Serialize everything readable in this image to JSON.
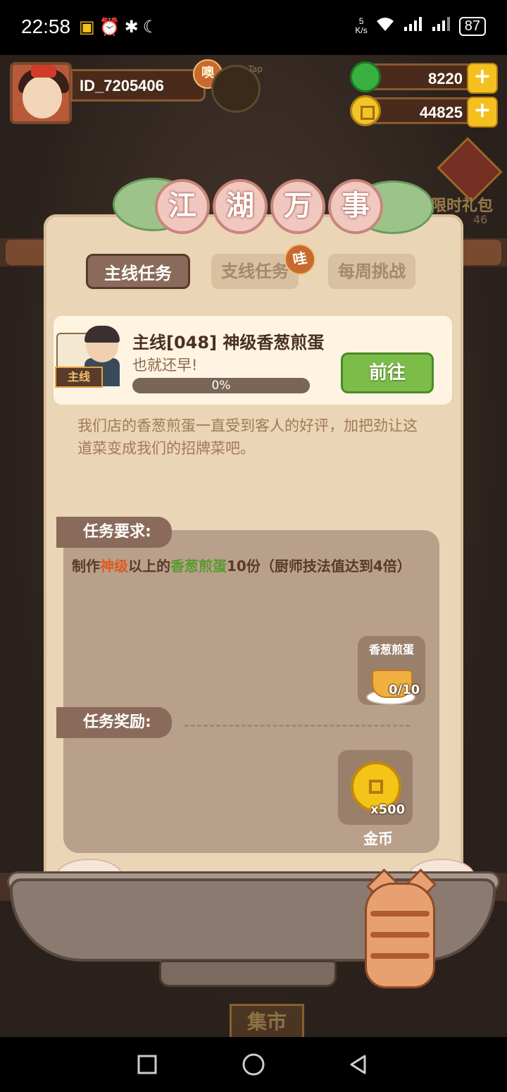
{
  "status_bar": {
    "time": "22:58",
    "net_speed": "5\nK/s",
    "battery": "87"
  },
  "hud": {
    "player_id": "ID_7205406",
    "id_badge": "噢",
    "tap_label": "Tap",
    "jade": "8220",
    "coins": "44825"
  },
  "side_event": {
    "label": "限时礼包",
    "timer": "46"
  },
  "panel": {
    "title_chars": [
      "江",
      "湖",
      "万",
      "事"
    ],
    "tabs": [
      {
        "label": "主线任务",
        "active": true
      },
      {
        "label": "支线任务",
        "active": false
      },
      {
        "label": "每周挑战",
        "active": false
      }
    ],
    "tab_badge": "哇"
  },
  "task": {
    "tag": "主线",
    "title": "主线[048] 神级香葱煎蛋",
    "subtitle": "也就还早!",
    "progress": 0,
    "progress_text": "0%",
    "go_label": "前往",
    "description": "我们店的香葱煎蛋一直受到客人的好评，加把劲让这道菜变成我们的招牌菜吧。"
  },
  "requirement": {
    "header": "任务要求:",
    "text_pre": "制作",
    "text_hl1": "神级",
    "text_mid": "以上的",
    "text_hl2": "香葱煎蛋",
    "text_post": "10份（厨师技法值达到4倍）",
    "item_name": "香葱煎蛋",
    "item_count": "0/10"
  },
  "reward": {
    "header": "任务奖励:",
    "count": "x500",
    "name": "金币"
  },
  "scene": {
    "market_sign": "集市"
  },
  "colors": {
    "panel_bg": "#ead5b6",
    "tab_active": "#8a6a5a",
    "go_button": "#7cbc48",
    "highlight_red": "#e05a20",
    "highlight_green": "#5a9a30"
  }
}
